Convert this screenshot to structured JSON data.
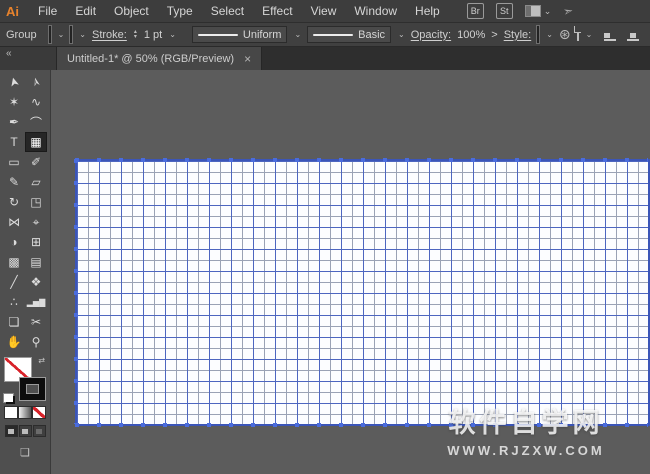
{
  "menubar": {
    "logo": "Ai",
    "items": [
      "File",
      "Edit",
      "Object",
      "Type",
      "Select",
      "Effect",
      "View",
      "Window",
      "Help"
    ],
    "bridge": "Br",
    "stock": "St"
  },
  "controlbar": {
    "selection_label": "Group",
    "stroke_label": "Stroke:",
    "stroke_weight": "1 pt",
    "profile": "Uniform",
    "brush": "Basic",
    "opacity_label": "Opacity:",
    "opacity_value": "100%",
    "overflow_chevron": ">",
    "style_label": "Style:"
  },
  "tabbar": {
    "collapse_glyph": "«",
    "title": "Untitled-1* @ 50% (RGB/Preview)",
    "close_glyph": "×"
  },
  "ui": {
    "chevron": "⌄",
    "stepper_up": "▴",
    "stepper_down": "▾",
    "recolor_glyph": "⊛",
    "share_glyph": "➣",
    "swap_glyph": "⇄",
    "screen_mode_glyph": "❏"
  },
  "tools": [
    {
      "name": "selection",
      "glyph": "➤"
    },
    {
      "name": "direct-selection",
      "glyph": "➢"
    },
    {
      "name": "magic-wand",
      "glyph": "✶"
    },
    {
      "name": "lasso",
      "glyph": "∿"
    },
    {
      "name": "pen",
      "glyph": "✒"
    },
    {
      "name": "curvature",
      "glyph": "⌒"
    },
    {
      "name": "type",
      "glyph": "T"
    },
    {
      "name": "rectangular-grid",
      "glyph": "▦",
      "active": true
    },
    {
      "name": "rectangle",
      "glyph": "▭"
    },
    {
      "name": "paintbrush",
      "glyph": "✐"
    },
    {
      "name": "shaper",
      "glyph": "✎"
    },
    {
      "name": "eraser",
      "glyph": "▱"
    },
    {
      "name": "rotate",
      "glyph": "↻"
    },
    {
      "name": "scale",
      "glyph": "◳"
    },
    {
      "name": "width",
      "glyph": "⋈"
    },
    {
      "name": "puppet-warp",
      "glyph": "⌖"
    },
    {
      "name": "shape-builder",
      "glyph": "◑"
    },
    {
      "name": "perspective-grid",
      "glyph": "⊞"
    },
    {
      "name": "mesh",
      "glyph": "▩"
    },
    {
      "name": "gradient",
      "glyph": "▤"
    },
    {
      "name": "eyedropper",
      "glyph": "╱"
    },
    {
      "name": "blend",
      "glyph": "❖"
    },
    {
      "name": "symbol-sprayer",
      "glyph": "∴"
    },
    {
      "name": "column-graph",
      "glyph": "▂▅▇"
    },
    {
      "name": "artboard",
      "glyph": "❏"
    },
    {
      "name": "slice",
      "glyph": "✂"
    },
    {
      "name": "hand",
      "glyph": "✋"
    },
    {
      "name": "zoom",
      "glyph": "⚲"
    }
  ],
  "canvas": {
    "watermark_line1": "软件自学网",
    "watermark_line2": "WWW.RJZXW.COM"
  },
  "colors": {
    "accent_blue": "#4a6cdc",
    "grid_line_blue": "#4d66c0",
    "grid_line_gray": "#9aa2b5",
    "artboard_white": "#fcfdff",
    "logo_orange": "#e8832c",
    "none_slash_red": "#d8232a"
  }
}
